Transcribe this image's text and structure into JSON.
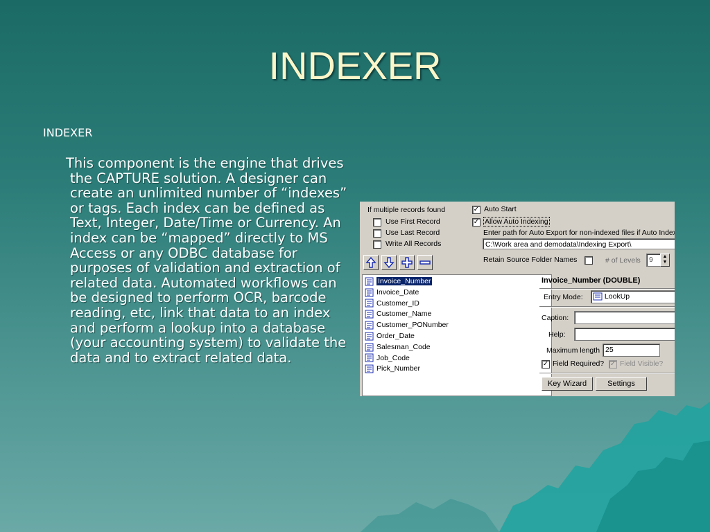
{
  "slide": {
    "title": "INDEXER",
    "bullet_heading": "INDEXER",
    "body": "This component is the engine that drives the CAPTURE solution.  A designer can create an unlimited number of  “indexes” or tags.  Each index can be defined as Text, Integer, Date/Time or Currency.  An index can be “mapped” directly to MS Access or any ODBC database for purposes of validation and extraction of related data.  Automated workflows can be designed to perform OCR, barcode reading, etc, link that data to an index and perform a lookup into a database (your accounting system) to validate the data and to extract related data."
  },
  "app": {
    "multiple_records_label": "If multiple records found",
    "options": [
      {
        "label": "Use First Record",
        "checked": false
      },
      {
        "label": "Use Last Record",
        "checked": false
      },
      {
        "label": "Write All Records",
        "checked": false
      }
    ],
    "auto_start": {
      "label": "Auto Start",
      "checked": true
    },
    "allow_auto_indexing": {
      "label": "Allow Auto Indexing",
      "checked": true
    },
    "auto_export_label": "Enter path for Auto Export for non-indexed files if Auto Index",
    "export_path": "C:\\Work area and demodata\\Indexing Export\\",
    "retain_label": "Retain Source Folder Names",
    "retain_checked": false,
    "levels_label": "# of Levels",
    "levels_value": "9",
    "index_list": [
      "Invoice_Number",
      "Invoice_Date",
      "Customer_ID",
      "Customer_Name",
      "Customer_PONumber",
      "Order_Date",
      "Salesman_Code",
      "Job_Code",
      "Pick_Number"
    ],
    "selected_index": 0,
    "detail_header": "Invoice_Number (DOUBLE)",
    "entry_mode_label": "Entry Mode:",
    "entry_mode_value": "LookUp",
    "caption_label": "Caption:",
    "caption_value": "",
    "help_label": "Help:",
    "help_value": "",
    "max_length_label": "Maximum length",
    "max_length_value": "25",
    "field_required": {
      "label": "Field Required?",
      "checked": true
    },
    "field_visible": {
      "label": "Field Visible?",
      "checked": true
    },
    "key_wizard_label": "Key Wizard",
    "settings_label": "Settings",
    "arrow_buttons": [
      "arrow-up-icon",
      "arrow-down-icon",
      "plus-icon",
      "minus-icon"
    ]
  }
}
